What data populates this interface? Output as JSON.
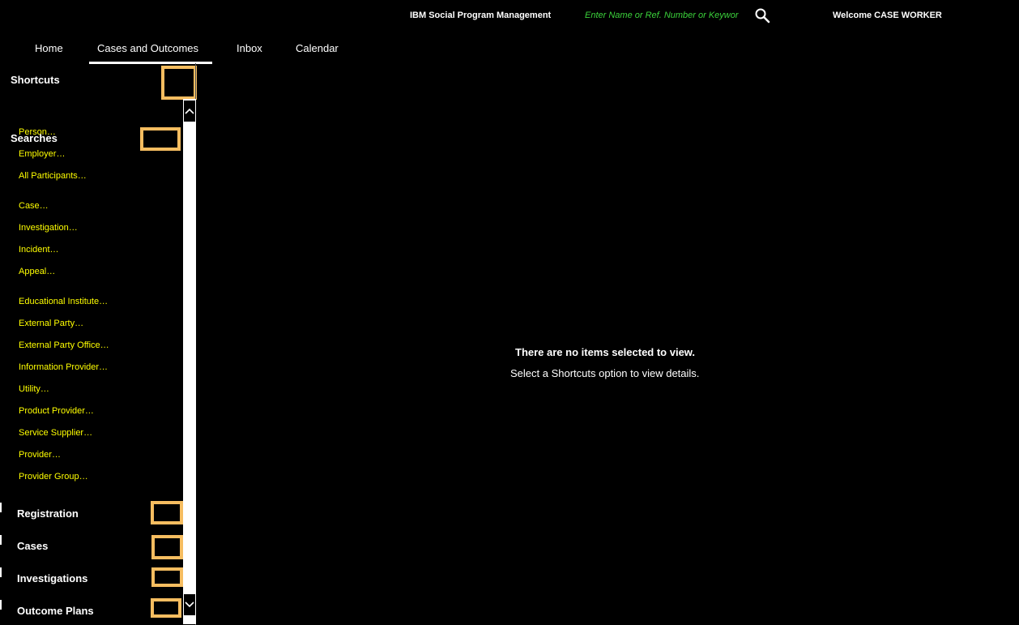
{
  "header": {
    "app_title": "IBM Social Program Management",
    "search_placeholder": "Enter Name or Ref. Number or Keywor",
    "search_value": "",
    "search_icon": "search-icon",
    "welcome_text": "Welcome CASE WORKER"
  },
  "tabs": [
    {
      "label": "Home"
    },
    {
      "label": "Cases and Outcomes",
      "active": true
    },
    {
      "label": "Inbox"
    },
    {
      "label": "Calendar"
    }
  ],
  "sidebar": {
    "shortcuts_title": "Shortcuts",
    "searches_title": "Searches",
    "links": [
      "Person…",
      "Employer…",
      "All Participants…",
      "Case…",
      "Investigation…",
      "Incident…",
      "Appeal…",
      "Educational Institute…",
      "External Party…",
      "External Party Office…",
      "Information Provider…",
      "Utility…",
      "Product Provider…",
      "Service Supplier…",
      "Provider…",
      "Provider Group…"
    ],
    "sections": [
      {
        "label": "Registration"
      },
      {
        "label": "Cases"
      },
      {
        "label": "Investigations"
      },
      {
        "label": "Outcome Plans"
      }
    ]
  },
  "main": {
    "empty_title": "There are no items selected to view.",
    "empty_subtitle": "Select a Shortcuts option to view details."
  },
  "colors": {
    "background": "#000000",
    "link": "#ffff00",
    "search_text": "#3bd23b",
    "focus_outline": "#f6bd60"
  }
}
